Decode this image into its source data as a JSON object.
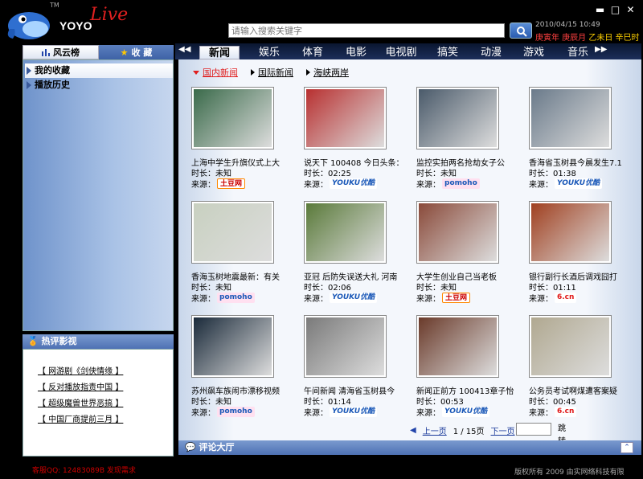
{
  "app": {
    "brand": "YOYO",
    "brand_live": "Live",
    "tm": "TM"
  },
  "window_controls": {
    "minimize": "▬",
    "maximize": "□",
    "close": "✕"
  },
  "search": {
    "placeholder": "请输入搜索关键字"
  },
  "header": {
    "datetime": "2010/04/15 10:49",
    "almanac_red": "庚寅年 庚辰月 ",
    "almanac_yellow": "乙未日 辛巳时"
  },
  "left_tabs": [
    {
      "label": "风云榜",
      "active": true
    },
    {
      "label": "收 藏",
      "active": false
    }
  ],
  "left_panel": {
    "items": [
      {
        "label": "我的收藏",
        "selected": true
      },
      {
        "label": "播放历史",
        "selected": false
      }
    ]
  },
  "hot_reviews": {
    "title": "热评影视",
    "items": [
      "【 网游剧《剑侠情缘 】",
      "【 反对播放指责中国 】",
      "【 超级魔兽世界恶搞 】",
      "【 中国厂商提前三月 】"
    ]
  },
  "category_tabs": [
    "新闻",
    "娱乐",
    "体育",
    "电影",
    "电视剧",
    "搞笑",
    "动漫",
    "游戏",
    "音乐"
  ],
  "active_category": "新闻",
  "sub_tabs": [
    {
      "label": "国内新闻",
      "active": true
    },
    {
      "label": "国际新闻",
      "active": false
    },
    {
      "label": "海峡两岸",
      "active": false
    }
  ],
  "duration_label": "时长：",
  "source_label": "来源：",
  "videos": [
    {
      "title": "上海中学生升旗仪式上大",
      "duration": "未知",
      "source": "土豆网",
      "source_type": "tudou",
      "thumb_color": "#3a6a4a"
    },
    {
      "title": "说天下 100408 今日头条：",
      "duration": "02:25",
      "source": "YOUKU优酷",
      "source_type": "youku",
      "thumb_color": "#b83030"
    },
    {
      "title": "监控实拍两名抢劫女子公",
      "duration": "未知",
      "source": "pomoho",
      "source_type": "pomoho",
      "thumb_color": "#4a5a6a"
    },
    {
      "title": "香海省玉树县今晨发生7.1",
      "duration": "01:38",
      "source": "YOUKU优酷",
      "source_type": "youku",
      "thumb_color": "#6a7a8a"
    },
    {
      "title": "香海玉树地震最新：有关",
      "duration": "未知",
      "source": "pomoho",
      "source_type": "pomoho",
      "thumb_color": "#c8d0c0"
    },
    {
      "title": "亚冠 后防失误送大礼 河南",
      "duration": "02:06",
      "source": "YOUKU优酷",
      "source_type": "youku",
      "thumb_color": "#5a7a3a"
    },
    {
      "title": "大学生创业自己当老板",
      "duration": "未知",
      "source": "土豆网",
      "source_type": "tudou",
      "thumb_color": "#8a4a3a"
    },
    {
      "title": "银行副行长酒后调戏囧打",
      "duration": "01:11",
      "source": "6.cn",
      "source_type": "6cn",
      "thumb_color": "#a04020"
    },
    {
      "title": "苏州飙车族闹市漂移视频",
      "duration": "未知",
      "source": "pomoho",
      "source_type": "pomoho",
      "thumb_color": "#1a2a3a"
    },
    {
      "title": "午间新闻 清海省玉树县今",
      "duration": "01:14",
      "source": "YOUKU优酷",
      "source_type": "youku",
      "thumb_color": "#7a7a7a"
    },
    {
      "title": "新闻正前方 100413章子怡",
      "duration": "00:53",
      "source": "YOUKU优酷",
      "source_type": "youku",
      "thumb_color": "#6a3a2a"
    },
    {
      "title": "公务员考试啊煤遭客案疑",
      "duration": "00:45",
      "source": "6.cn",
      "source_type": "6cn",
      "thumb_color": "#b0a890"
    }
  ],
  "pager": {
    "prev": "上一页",
    "info": "1 / 15页",
    "next": "下一页",
    "go": "跳转"
  },
  "comment_bar": {
    "title": "评论大厅"
  },
  "footer": {
    "left": "客服QQ: 12483089B  发现需求",
    "right": "版权所有 2009 由实网络科技有限"
  },
  "colors": {
    "accent_red": "#e02020",
    "nav_blue": "#4e71b4"
  }
}
